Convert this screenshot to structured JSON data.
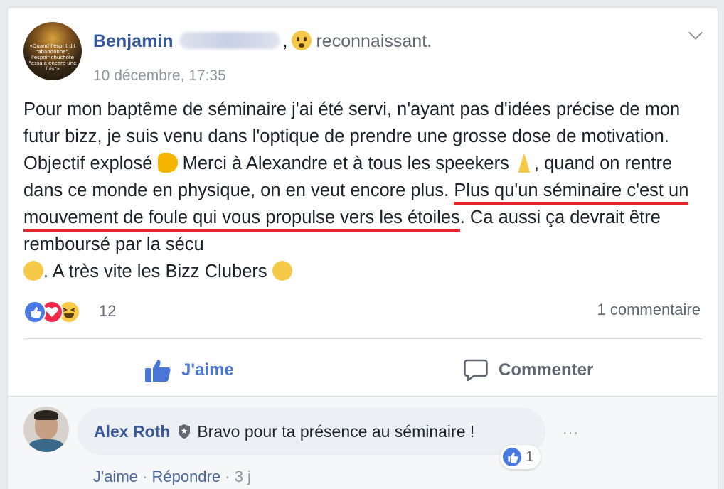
{
  "post": {
    "author": "Benjamin",
    "comma": ",",
    "feeling": "reconnaissant.",
    "date": "10 décembre, 17:35",
    "text_1": "Pour mon baptême de séminaire j'ai été servi, n'ayant pas d'idées précise de mon futur bizz, je suis venu dans l'optique de prendre une grosse dose de motivation. Objectif explosé ",
    "text_2": " Merci à Alexandre et à tous les speekers ",
    "text_3": ", quand on rentre dans ce monde en physique, on en veut encore plus. ",
    "text_underlined": "Plus qu'un séminaire c'est un mouvement de foule qui vous propulse vers les étoiles",
    "text_4": ". Ca aussi ça devrait être remboursé par la sécu ",
    "text_5": ". A très vite les Bizz Clubers ",
    "avatar_text": "«Quand l'esprit dit \"abandonne\", l'espoir chuchote \"essaie encore une fois\"»"
  },
  "reactions": {
    "count": "12",
    "comments_count": "1 commentaire",
    "types": [
      "like",
      "love",
      "haha"
    ]
  },
  "actions": {
    "like_label": "J'aime",
    "comment_label": "Commenter"
  },
  "comment": {
    "author": "Alex Roth",
    "text": "Bravo pour ta présence au séminaire !",
    "likes": "1",
    "like_link": "J'aime",
    "reply_link": "Répondre",
    "separator": "·",
    "age": "3 j",
    "more": "···"
  },
  "colors": {
    "link_blue": "#365899",
    "like_blue": "#4a76d8",
    "underline_red": "#e3262b",
    "meta_gray": "#90949c"
  }
}
